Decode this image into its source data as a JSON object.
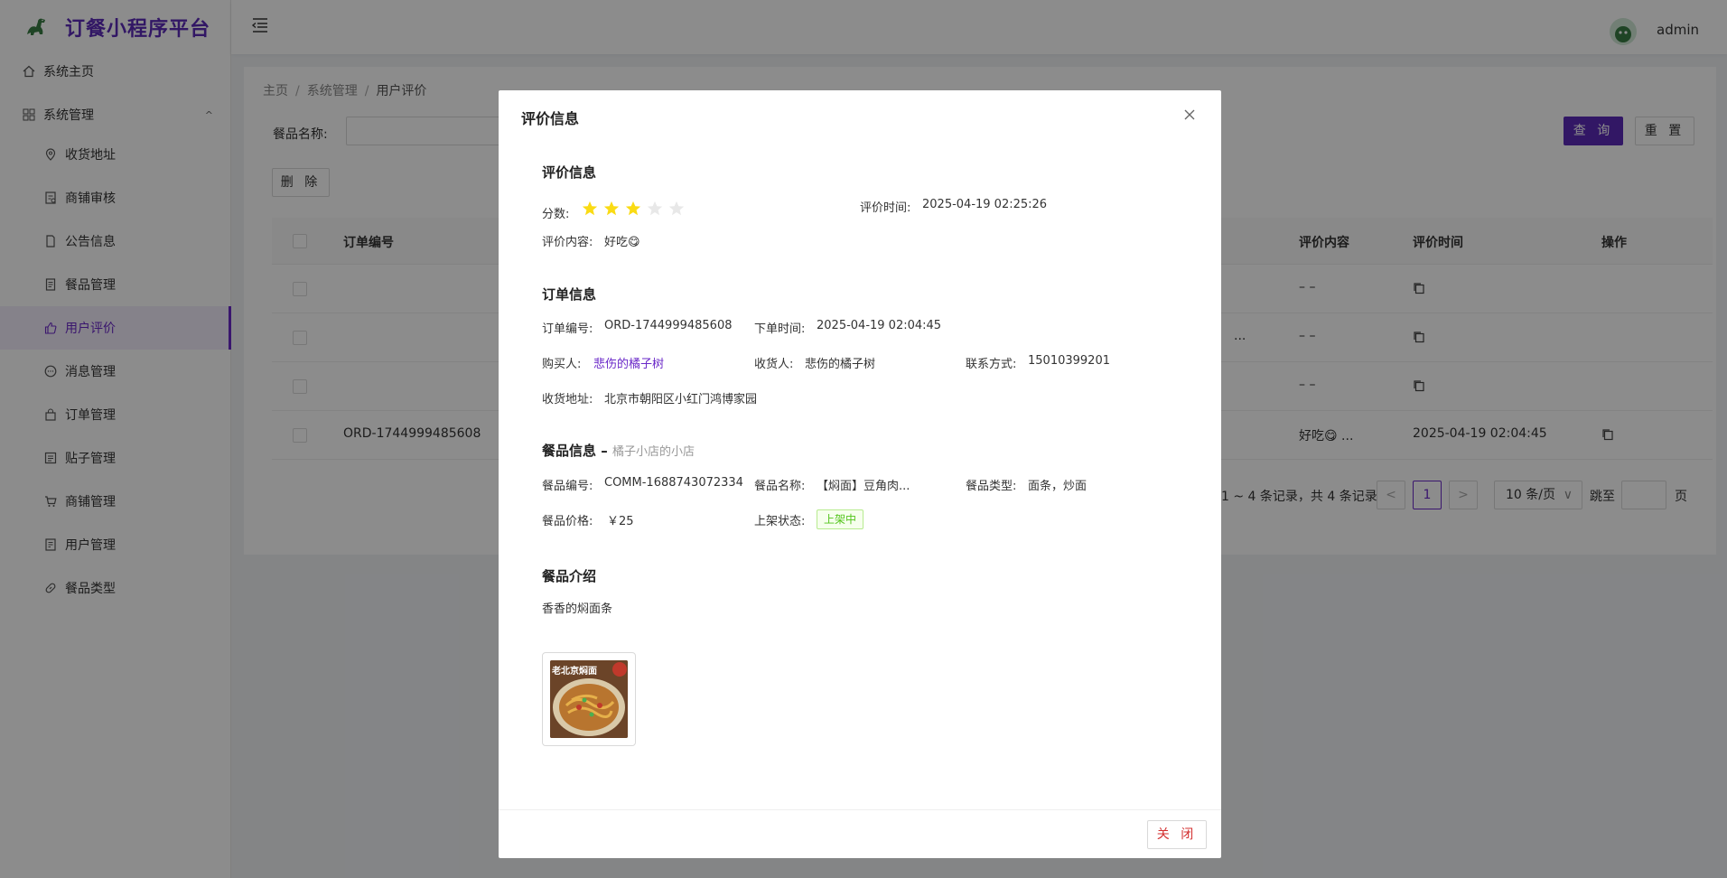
{
  "app": {
    "title": "订餐小程序平台",
    "user": "admin"
  },
  "colors": {
    "brand": "#5b2bb8",
    "active": "#6a28c8",
    "success": "#52c41a",
    "danger": "#d32f2f",
    "star": "#fadb14"
  },
  "sidebar": {
    "home": {
      "label": "系统主页",
      "icon": "home-icon"
    },
    "group": {
      "label": "系统管理",
      "icon": "grid-icon"
    },
    "items": [
      {
        "label": "收货地址",
        "icon": "location-icon"
      },
      {
        "label": "商铺审核",
        "icon": "audit-icon"
      },
      {
        "label": "公告信息",
        "icon": "notice-icon"
      },
      {
        "label": "餐品管理",
        "icon": "document-icon"
      },
      {
        "label": "用户评价",
        "icon": "thumbs-up-icon",
        "active": true
      },
      {
        "label": "消息管理",
        "icon": "message-icon"
      },
      {
        "label": "订单管理",
        "icon": "bag-icon"
      },
      {
        "label": "贴子管理",
        "icon": "post-icon"
      },
      {
        "label": "商铺管理",
        "icon": "cart-icon"
      },
      {
        "label": "用户管理",
        "icon": "user-doc-icon"
      },
      {
        "label": "餐品类型",
        "icon": "link-icon"
      }
    ]
  },
  "breadcrumb": [
    "主页",
    "系统管理",
    "用户评价"
  ],
  "filter": {
    "label": "餐品名称:",
    "query": "查 询",
    "reset": "重 置"
  },
  "toolbar": {
    "delete": "删 除"
  },
  "table": {
    "headers": {
      "order_no": "订单编号",
      "content": "评价内容",
      "time": "评价时间",
      "ops": "操作"
    },
    "rows": [
      {
        "order_no": "",
        "content": "– –",
        "time": "",
        "mid": ""
      },
      {
        "order_no": "",
        "content": "– –",
        "time": "",
        "mid": "..."
      },
      {
        "order_no": "",
        "content": "– –",
        "time": "",
        "mid": ""
      },
      {
        "order_no": "ORD-1744999485608",
        "content": "好吃😋 ...",
        "time": "2025-04-19 02:04:45",
        "mid": ""
      }
    ]
  },
  "pagination": {
    "summary": "1 ~ 4 条记录，共 4 条记录",
    "current": "1",
    "page_size": "10 条/页",
    "jump_label": "跳至",
    "page_suffix": "页"
  },
  "modal": {
    "title": "评价信息",
    "review": {
      "section": "评价信息",
      "score_label": "分数:",
      "score": 3,
      "max_score": 5,
      "time_label": "评价时间:",
      "time": "2025-04-19 02:25:26",
      "content_label": "评价内容:",
      "content": "好吃😋"
    },
    "order": {
      "section": "订单信息",
      "no_label": "订单编号:",
      "no": "ORD-1744999485608",
      "time_label": "下单时间:",
      "time": "2025-04-19 02:04:45",
      "buyer_label": "购买人:",
      "buyer": "悲伤的橘子树",
      "receiver_label": "收货人:",
      "receiver": "悲伤的橘子树",
      "contact_label": "联系方式:",
      "contact": "15010399201",
      "address_label": "收货地址:",
      "address": "北京市朝阳区小红门鸿博家园"
    },
    "food": {
      "section": "餐品信息",
      "dash": "–",
      "shop": "橘子小店的小店",
      "no_label": "餐品编号:",
      "no": "COMM-1688743072334",
      "name_label": "餐品名称:",
      "name": "【焖面】豆角肉...",
      "type_label": "餐品类型:",
      "type": "面条，炒面",
      "price_label": "餐品价格:",
      "price": "￥25",
      "status_label": "上架状态:",
      "status": "上架中"
    },
    "intro": {
      "section": "餐品介绍",
      "text": "香香的焖面条"
    },
    "image_caption": "老北京焖面",
    "close": "关 闭"
  }
}
